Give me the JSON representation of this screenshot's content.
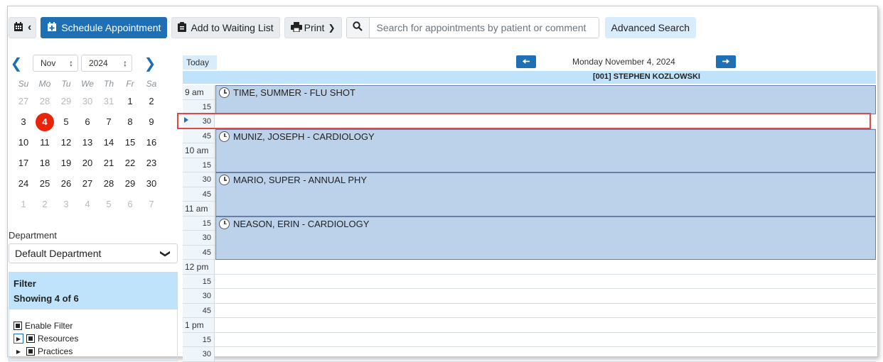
{
  "toolbar": {
    "schedule_label": "Schedule Appointment",
    "waiting_label": "Add to Waiting List",
    "print_label": "Print",
    "search_placeholder": "Search for appointments by patient or comment",
    "advanced_label": "Advanced Search"
  },
  "calendar": {
    "month": "Nov",
    "year": "2024",
    "dow": [
      "Su",
      "Mo",
      "Tu",
      "We",
      "Th",
      "Fr",
      "Sa"
    ],
    "weeks": [
      [
        {
          "d": "27",
          "m": true
        },
        {
          "d": "28",
          "m": true
        },
        {
          "d": "29",
          "m": true
        },
        {
          "d": "30",
          "m": true
        },
        {
          "d": "31",
          "m": true
        },
        {
          "d": "1"
        },
        {
          "d": "2"
        }
      ],
      [
        {
          "d": "3"
        },
        {
          "d": "4",
          "today": true
        },
        {
          "d": "5"
        },
        {
          "d": "6"
        },
        {
          "d": "7"
        },
        {
          "d": "8"
        },
        {
          "d": "9"
        }
      ],
      [
        {
          "d": "10"
        },
        {
          "d": "11"
        },
        {
          "d": "12"
        },
        {
          "d": "13"
        },
        {
          "d": "14"
        },
        {
          "d": "15"
        },
        {
          "d": "16"
        }
      ],
      [
        {
          "d": "17"
        },
        {
          "d": "18"
        },
        {
          "d": "19"
        },
        {
          "d": "20"
        },
        {
          "d": "21"
        },
        {
          "d": "22"
        },
        {
          "d": "23"
        }
      ],
      [
        {
          "d": "24"
        },
        {
          "d": "25"
        },
        {
          "d": "26"
        },
        {
          "d": "27"
        },
        {
          "d": "28"
        },
        {
          "d": "29"
        },
        {
          "d": "30"
        }
      ],
      [
        {
          "d": "1",
          "m": true
        },
        {
          "d": "2",
          "m": true
        },
        {
          "d": "3",
          "m": true
        },
        {
          "d": "4",
          "m": true
        },
        {
          "d": "5",
          "m": true
        },
        {
          "d": "6",
          "m": true
        },
        {
          "d": "7",
          "m": true
        }
      ]
    ]
  },
  "department": {
    "label": "Department",
    "value": "Default Department"
  },
  "filter": {
    "title": "Filter",
    "showing": "Showing 4 of 6",
    "enable": "Enable Filter",
    "resources": "Resources",
    "practices": "Practices"
  },
  "schedule": {
    "today_label": "Today",
    "date": "Monday November 4, 2024",
    "resource": "[001] STEPHEN KOZLOWSKI",
    "slots": [
      "9 am",
      "15",
      "30",
      "45",
      "10 am",
      "15",
      "30",
      "45",
      "11 am",
      "15",
      "30",
      "45",
      "12 pm",
      "15",
      "30",
      "45",
      "1 pm",
      "15",
      "30"
    ],
    "hour_slots": [
      0,
      4,
      8,
      12,
      16
    ],
    "appointments": [
      {
        "label": "TIME, SUMMER - FLU SHOT",
        "start": 0,
        "length": 2
      },
      {
        "label": "MUNIZ, JOSEPH - CARDIOLOGY",
        "start": 3,
        "length": 3
      },
      {
        "label": "MARIO, SUPER - ANNUAL PHY",
        "start": 6,
        "length": 3
      },
      {
        "label": "NEASON, ERIN - CARDIOLOGY",
        "start": 9,
        "length": 3
      }
    ],
    "current_slot": 2
  },
  "colors": {
    "primary": "#1f6fb5",
    "today_circle": "#e8250b",
    "appointment": "#bcd2ea",
    "header_bar": "#bfe3fb",
    "highlight": "#e04848"
  }
}
